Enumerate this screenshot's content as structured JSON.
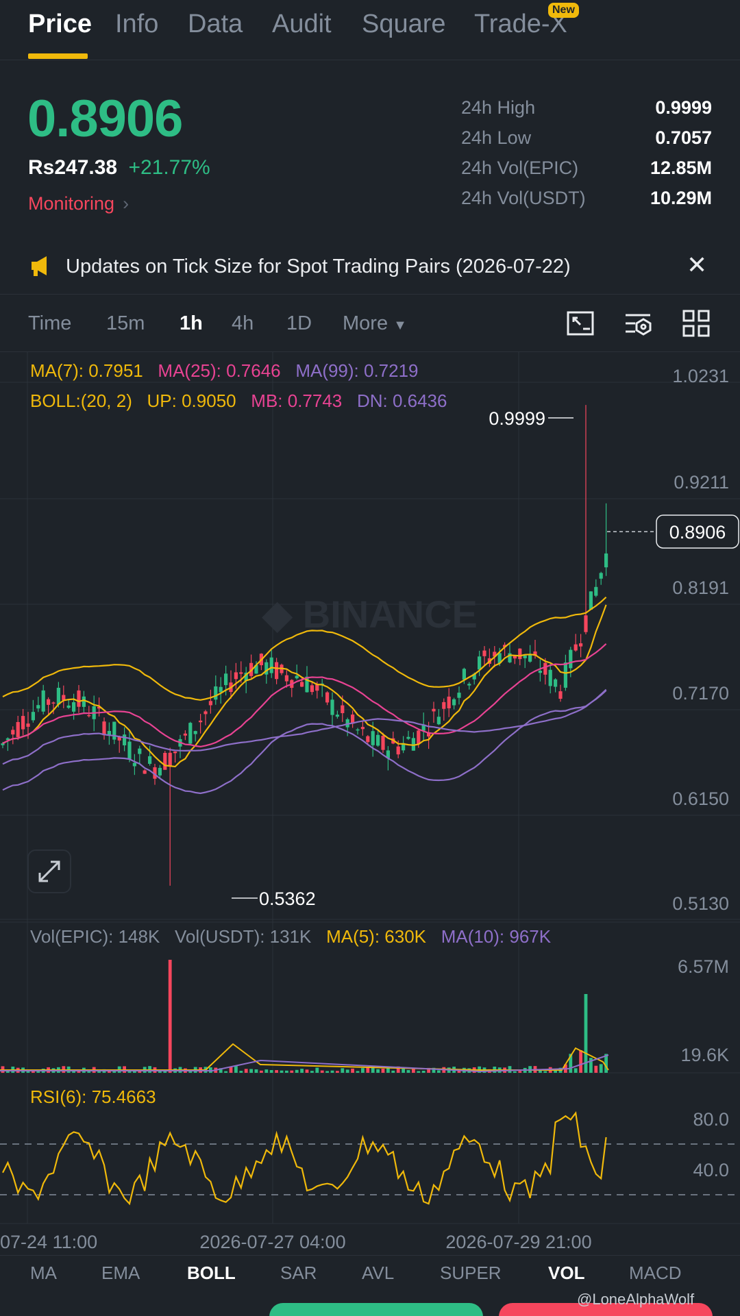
{
  "tabs": [
    {
      "label": "Price",
      "active": true
    },
    {
      "label": "Info"
    },
    {
      "label": "Data"
    },
    {
      "label": "Audit"
    },
    {
      "label": "Square"
    },
    {
      "label": "Trade-X",
      "badge": "New"
    }
  ],
  "header": {
    "last_price": "0.8906",
    "fiat_price": "Rs247.38",
    "change_pct": "+21.77%",
    "monitoring": "Monitoring"
  },
  "stats": [
    {
      "label": "24h High",
      "value": "0.9999"
    },
    {
      "label": "24h Low",
      "value": "0.7057"
    },
    {
      "label": "24h Vol(EPIC)",
      "value": "12.85M"
    },
    {
      "label": "24h Vol(USDT)",
      "value": "10.29M"
    }
  ],
  "notice": {
    "icon": "megaphone-icon",
    "text": "Updates on Tick Size for Spot Trading Pairs (2026-07-22)"
  },
  "intervals": [
    "Time",
    "15m",
    "1h",
    "4h",
    "1D",
    "More"
  ],
  "active_interval": "1h",
  "legend": {
    "ma7": "MA(7): 0.7951",
    "ma25": "MA(25): 0.7646",
    "ma99": "MA(99): 0.7219",
    "boll": "BOLL:(20, 2)",
    "up": "UP: 0.9050",
    "mb": "MB: 0.7743",
    "dn": "DN: 0.6436",
    "vol_epic": "Vol(EPIC): 148K",
    "vol_usdt": "Vol(USDT): 131K",
    "vol_ma5": "MA(5): 630K",
    "vol_ma10": "MA(10): 967K",
    "rsi": "RSI(6): 75.4663"
  },
  "watermark_text": "BINANCE",
  "chart_data": {
    "type": "candlestick",
    "price_axis": [
      "1.0231",
      "0.9211",
      "0.8191",
      "0.7170",
      "0.6150",
      "0.5130"
    ],
    "price_ylim": [
      0.513,
      1.0231
    ],
    "current_price": "0.8906",
    "high_label": "0.9999",
    "low_label": "0.5362",
    "volume_axis": [
      "6.57M",
      "19.6K"
    ],
    "rsi_axis": [
      "80.0",
      "40.0"
    ],
    "rsi_lines": [
      70,
      30
    ],
    "x_labels": [
      "07-24 11:00",
      "2026-07-27 04:00",
      "2026-07-29 21:00"
    ],
    "grid": true,
    "colors": {
      "up": "#2ebd85",
      "down": "#f6465d",
      "ma7": "#f0b90b",
      "ma25": "#e84393",
      "ma99": "#8e6fc9",
      "boll": "#f0b90b"
    }
  },
  "indicators": [
    "MA",
    "EMA",
    "BOLL",
    "SAR",
    "AVL",
    "SUPER",
    "VOL",
    "MACD"
  ],
  "active_indicators": [
    "BOLL",
    "VOL"
  ],
  "footer": {
    "watermark": "@LoneAlphaWolf"
  }
}
